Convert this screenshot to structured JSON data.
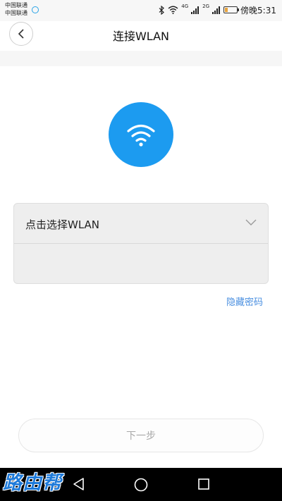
{
  "status_bar": {
    "carrier_1": "中国联通",
    "carrier_2": "中国联通",
    "net_type_1": "4G",
    "net_type_2": "2G",
    "time": "傍晚5:31",
    "battery_color": "#e8a33b"
  },
  "header": {
    "title": "连接WLAN",
    "back_icon": "chevron-left-icon"
  },
  "wifi_badge": {
    "icon": "wifi-icon",
    "color": "#1c9bf0"
  },
  "form": {
    "ssid_select_label": "点击选择WLAN",
    "ssid_icon": "chevron-down-icon",
    "password_value": "",
    "hide_password_label": "隐藏密码"
  },
  "next_button_label": "下一步",
  "nav_bar": {
    "watermark": "路由帮",
    "buttons": [
      "back-triangle-icon",
      "home-circle-icon",
      "recent-square-icon"
    ]
  }
}
